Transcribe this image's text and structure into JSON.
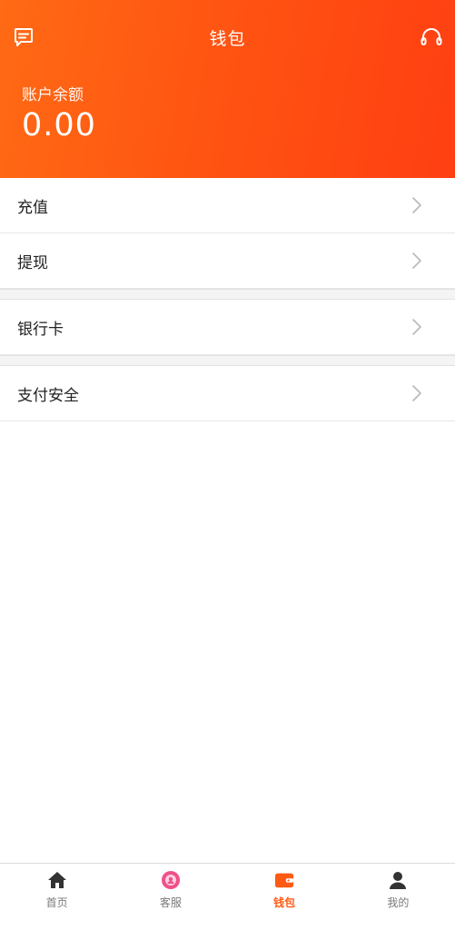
{
  "header": {
    "title": "钱包",
    "message_icon": "message-icon",
    "service_icon": "headset-icon"
  },
  "balance": {
    "label": "账户余额",
    "value": "0.00"
  },
  "menu": {
    "groups": [
      {
        "items": [
          {
            "label": "充值"
          },
          {
            "label": "提现"
          }
        ]
      },
      {
        "items": [
          {
            "label": "银行卡"
          }
        ]
      },
      {
        "items": [
          {
            "label": "支付安全"
          }
        ]
      }
    ]
  },
  "tabbar": {
    "items": [
      {
        "label": "首页",
        "icon": "home-icon",
        "active": false
      },
      {
        "label": "客服",
        "icon": "service-avatar-icon",
        "active": false
      },
      {
        "label": "钱包",
        "icon": "wallet-icon",
        "active": true
      },
      {
        "label": "我的",
        "icon": "user-icon",
        "active": false
      }
    ]
  },
  "colors": {
    "accent": "#ff5512",
    "accent_dark": "#ff3f12",
    "tab_active": "#ff5a14",
    "tab_inactive": "#7a7a7a",
    "service_pink": "#f04f8a"
  }
}
